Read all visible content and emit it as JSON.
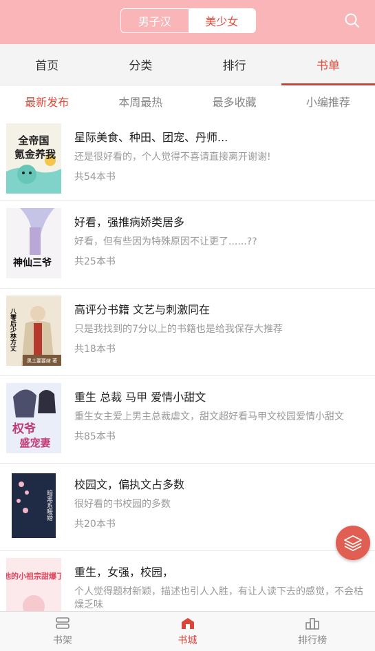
{
  "header": {
    "segments": [
      "男子汉",
      "美少女"
    ],
    "active_segment": "美少女",
    "search_icon": "search-icon"
  },
  "tabs": [
    {
      "label": "首页",
      "active": false
    },
    {
      "label": "分类",
      "active": false
    },
    {
      "label": "排行",
      "active": false
    },
    {
      "label": "书单",
      "active": true
    }
  ],
  "subtabs": [
    {
      "label": "最新发布",
      "active": true
    },
    {
      "label": "本周最热",
      "active": false
    },
    {
      "label": "最多收藏",
      "active": false
    },
    {
      "label": "小编推荐",
      "active": false
    }
  ],
  "booklists": [
    {
      "title": "星际美食、种田、团宠、丹师...",
      "desc": "还是很好看的，个人觉得不喜请直接离开谢谢!",
      "count": "共54本书"
    },
    {
      "title": "好看，强推病娇类居多",
      "desc": "好看，但有些因为特殊原因不让更了......??",
      "count": "共25本书"
    },
    {
      "title": "高评分书籍 文艺与刺激同在",
      "desc": "只是我找到的7分以上的书籍也是给我保存大推荐",
      "count": "共18本书"
    },
    {
      "title": "重生 总裁 马甲 爱情小甜文",
      "desc": "重生女主爱上男主总裁虐文，甜文超好看马甲文校园爱情小甜文",
      "count": "共85本书"
    },
    {
      "title": "校园文，偏执文占多数",
      "desc": "很好看的书校园的多数",
      "count": "共20本书"
    },
    {
      "title": "重生，女强，校园，",
      "desc": "个人觉得题材新颖，描述也引人入胜，有让人读下去的感觉，不会枯燥乏味",
      "count": ""
    }
  ],
  "covers": {
    "c1": {
      "line1": "全帝国",
      "line2": "氪金养我"
    },
    "c2": {
      "text": "神仙三爷"
    },
    "c3": {
      "text": "八零后少林方丈",
      "author": "黑土要要嫁 著"
    },
    "c4": {
      "line1": "权爷",
      "line2": "盛宠妻"
    },
    "c5": {
      "text": "暗黑系暖婚"
    },
    "c6": {
      "text": "他的小祖宗甜爆了"
    }
  },
  "bottom_nav": [
    {
      "label": "书架",
      "icon": "bookshelf-icon",
      "active": false
    },
    {
      "label": "书城",
      "icon": "bookstore-icon",
      "active": true
    },
    {
      "label": "排行榜",
      "icon": "ranking-icon",
      "active": false
    }
  ],
  "fab_icon": "layers-icon",
  "colors": {
    "header_bg": "#f9b5b8",
    "accent": "#e64b3c",
    "fab": "#e05f52"
  }
}
